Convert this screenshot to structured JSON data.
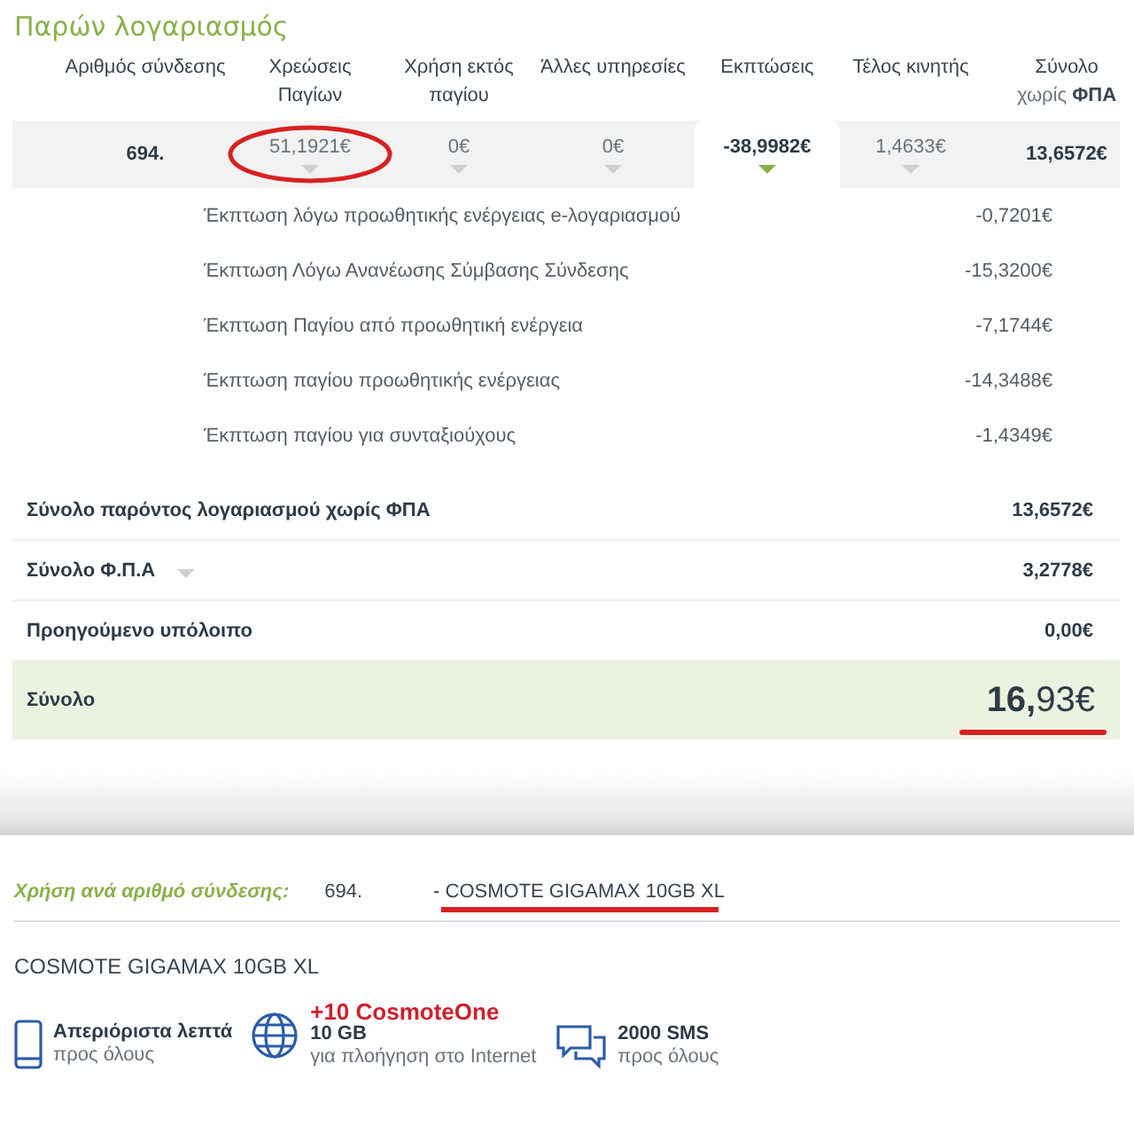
{
  "bill": {
    "title": "Παρών λογαριασμός",
    "columns": [
      {
        "label": "Αριθμός σύνδεσης"
      },
      {
        "label": "Χρεώσεις Παγίων"
      },
      {
        "label": "Χρήση εκτός παγίου"
      },
      {
        "label": "Άλλες υπηρεσίες"
      },
      {
        "label": "Εκπτώσεις"
      },
      {
        "label": "Τέλος κινητής"
      },
      {
        "label": "Σύνολο",
        "label_bold": "ΦΠΑ",
        "label_light": "χωρίς"
      }
    ],
    "row": [
      {
        "value": "694.",
        "kind": "number"
      },
      {
        "value": "51,1921€",
        "kind": "amount",
        "expanded": false,
        "bold": false,
        "circled": true
      },
      {
        "value": "0€",
        "kind": "amount",
        "expanded": false,
        "bold": false,
        "circled": false
      },
      {
        "value": "0€",
        "kind": "amount",
        "expanded": false,
        "bold": false,
        "circled": false
      },
      {
        "value": "-38,9982€",
        "kind": "amount",
        "expanded": true,
        "bold": true,
        "circled": false
      },
      {
        "value": "1,4633€",
        "kind": "amount",
        "expanded": false,
        "bold": false,
        "circled": false
      },
      {
        "value": "13,6572€",
        "kind": "total",
        "bold": true
      }
    ],
    "discounts": [
      {
        "label": "Έκπτωση λόγω προωθητικής ενέργειας e-λογαριασμού",
        "value": "-0,7201€"
      },
      {
        "label": "Έκπτωση Λόγω Ανανέωσης Σύμβασης Σύνδεσης",
        "value": "-15,3200€"
      },
      {
        "label": "Έκπτωση Παγίου από προωθητική ενέργεια",
        "value": "-7,1744€"
      },
      {
        "label": "Έκπτωση παγίου προωθητικής ενέργειας",
        "value": "-14,3488€"
      },
      {
        "label": "Έκπτωση παγίου για συνταξιούχους",
        "value": "-1,4349€"
      }
    ],
    "totals": [
      {
        "label": "Σύνολο παρόντος λογαριασμού χωρίς ΦΠΑ",
        "value": "13,6572€",
        "expandable": false
      },
      {
        "label": "Σύνολο Φ.Π.Α",
        "value": "3,2778€",
        "expandable": true
      },
      {
        "label": "Προηγούμενο υπόλοιπο",
        "value": "0,00€",
        "expandable": false
      }
    ],
    "grand_total": {
      "label": "Σύνολο",
      "value": "**16,**93€",
      "underlined": true
    }
  },
  "usage": {
    "label": "Χρήση ανά αριθμό σύνδεσης:",
    "number": "694.",
    "plan": "- COSMOTE GIGAMAX 10GB XL",
    "underlined": true,
    "plan_name": "COSMOTE GIGAMAX 10GB XL",
    "features": [
      {
        "kind": "phone",
        "title": "Απεριόριστα λεπτά",
        "subtitle": "προς όλους"
      },
      {
        "kind": "globe",
        "promo": "+10 CosmoteOne",
        "title": "10 GB",
        "subtitle": "για πλοήγηση στο Internet"
      },
      {
        "kind": "chat",
        "title": "2000 SMS",
        "subtitle": "προς όλους"
      }
    ]
  }
}
